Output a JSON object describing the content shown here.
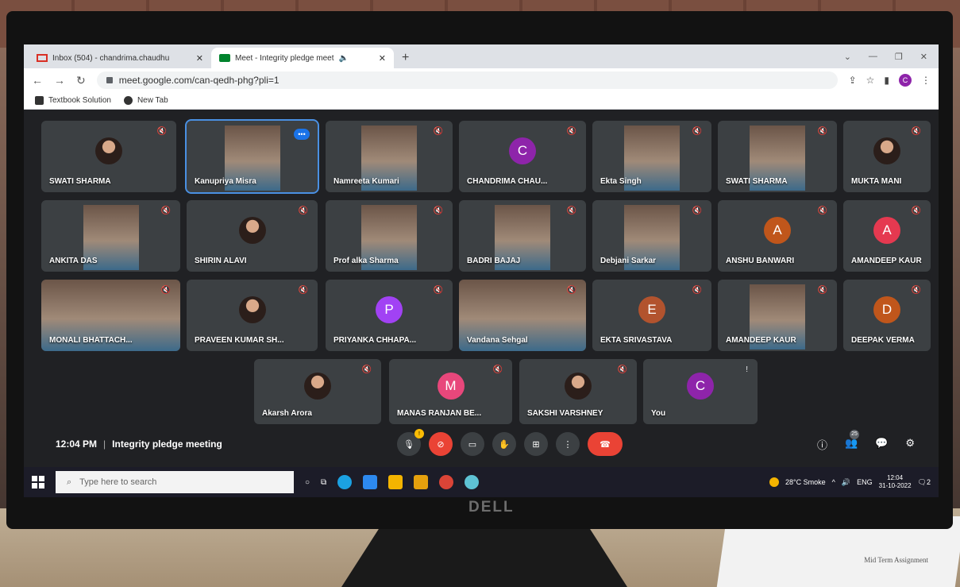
{
  "browser": {
    "tabs": [
      {
        "title": "Inbox (504) - chandrima.chaudhu",
        "active": false
      },
      {
        "title": "Meet - Integrity pledge meet",
        "active": true
      }
    ],
    "new_tab_label": "+",
    "url": "meet.google.com/can-qedh-phg?pli=1",
    "profile_initial": "C",
    "bookmarks": [
      "Textbook Solution",
      "New Tab"
    ]
  },
  "participants": [
    {
      "name": "SWATI SHARMA",
      "kind": "photo"
    },
    {
      "name": "Kanupriya Misra",
      "kind": "video",
      "active": true
    },
    {
      "name": "Namreeta Kumari",
      "kind": "video"
    },
    {
      "name": "CHANDRIMA CHAU...",
      "kind": "initial",
      "initial": "C",
      "color": "#8e24aa"
    },
    {
      "name": "Ekta Singh",
      "kind": "video"
    },
    {
      "name": "SWATI SHARMA",
      "kind": "video"
    },
    {
      "name": "MUKTA MANI",
      "kind": "photo"
    },
    {
      "name": "ANKITA DAS",
      "kind": "video"
    },
    {
      "name": "SHIRIN ALAVI",
      "kind": "photo"
    },
    {
      "name": "Prof alka Sharma",
      "kind": "video"
    },
    {
      "name": "BADRI BAJAJ",
      "kind": "video"
    },
    {
      "name": "Debjani Sarkar",
      "kind": "video"
    },
    {
      "name": "ANSHU BANWARI",
      "kind": "initial",
      "initial": "A",
      "color": "#c0561b"
    },
    {
      "name": "AMANDEEP KAUR",
      "kind": "initial",
      "initial": "A",
      "color": "#e53950"
    },
    {
      "name": "MONALI BHATTACH...",
      "kind": "video"
    },
    {
      "name": "PRAVEEN KUMAR SH...",
      "kind": "photo"
    },
    {
      "name": "PRIYANKA CHHAPA...",
      "kind": "initial",
      "initial": "P",
      "color": "#a142f4"
    },
    {
      "name": "Vandana Sehgal",
      "kind": "video"
    },
    {
      "name": "EKTA SRIVASTAVA",
      "kind": "initial",
      "initial": "E",
      "color": "#b2532e"
    },
    {
      "name": "AMANDEEP KAUR",
      "kind": "video"
    },
    {
      "name": "DEEPAK VERMA",
      "kind": "initial",
      "initial": "D",
      "color": "#c0561b"
    },
    {
      "name": "Akarsh Arora",
      "kind": "photo"
    },
    {
      "name": "MANAS RANJAN BE...",
      "kind": "initial",
      "initial": "M",
      "color": "#e8477b"
    },
    {
      "name": "SAKSHI VARSHNEY",
      "kind": "photo"
    },
    {
      "name": "You",
      "kind": "initial",
      "initial": "C",
      "color": "#8e24aa"
    }
  ],
  "meeting": {
    "time": "12:04 PM",
    "separator": "|",
    "title": "Integrity pledge meeting",
    "mic_badge": "!",
    "people_count": "25"
  },
  "taskbar": {
    "search_placeholder": "Type here to search",
    "weather": "28°C Smoke",
    "language": "ENG",
    "clock_time": "12:04",
    "clock_date": "31-10-2022",
    "notification_count": "2"
  },
  "hardware": {
    "brand": "DELL",
    "paper_text": "Mid Term Assignment"
  }
}
